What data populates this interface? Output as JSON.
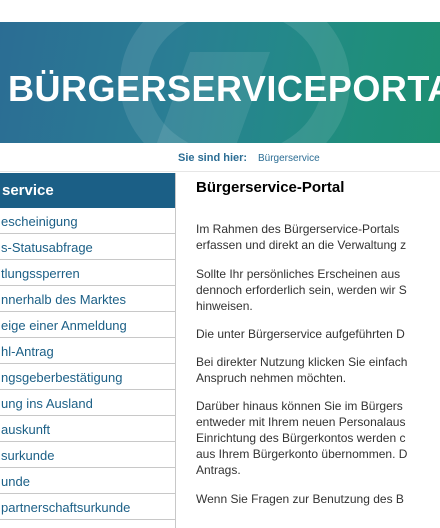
{
  "banner": {
    "title": "BÜRGERSERVICEPORTAL"
  },
  "breadcrumb": {
    "label": "Sie sind hier:",
    "current": "Bürgerservice"
  },
  "sidebar": {
    "heading": "service",
    "items": [
      {
        "label": "escheinigung"
      },
      {
        "label": "s-Statusabfrage"
      },
      {
        "label": "tlungssperren"
      },
      {
        "label": "nnerhalb des Marktes"
      },
      {
        "label": "eige einer Anmeldung"
      },
      {
        "label": "hl-Antrag"
      },
      {
        "label": "ngsgeberbestätigung"
      },
      {
        "label": "ung ins Ausland"
      },
      {
        "label": "auskunft"
      },
      {
        "label": "surkunde"
      },
      {
        "label": "unde"
      },
      {
        "label": "partnerschaftsurkunde"
      }
    ]
  },
  "main": {
    "title": "Bürgerservice-Portal",
    "paragraphs": [
      [
        "Im Rahmen des Bürgerservice-Portals",
        "erfassen und direkt an die Verwaltung z"
      ],
      [
        "Sollte Ihr persönliches Erscheinen aus",
        "dennoch erforderlich sein, werden wir S",
        "hinweisen."
      ],
      [
        "Die unter Bürgerservice aufgeführten D"
      ],
      [
        "Bei direkter Nutzung klicken Sie einfach",
        "Anspruch nehmen möchten."
      ],
      [
        "Darüber hinaus können Sie im Bürgers",
        "entweder mit Ihrem neuen Personalaus",
        "Einrichtung des Bürgerkontos werden c",
        "aus Ihrem Bürgerkonto übernommen. D",
        "Antrags."
      ],
      [
        "Wenn Sie Fragen zur Benutzung des B"
      ]
    ]
  }
}
